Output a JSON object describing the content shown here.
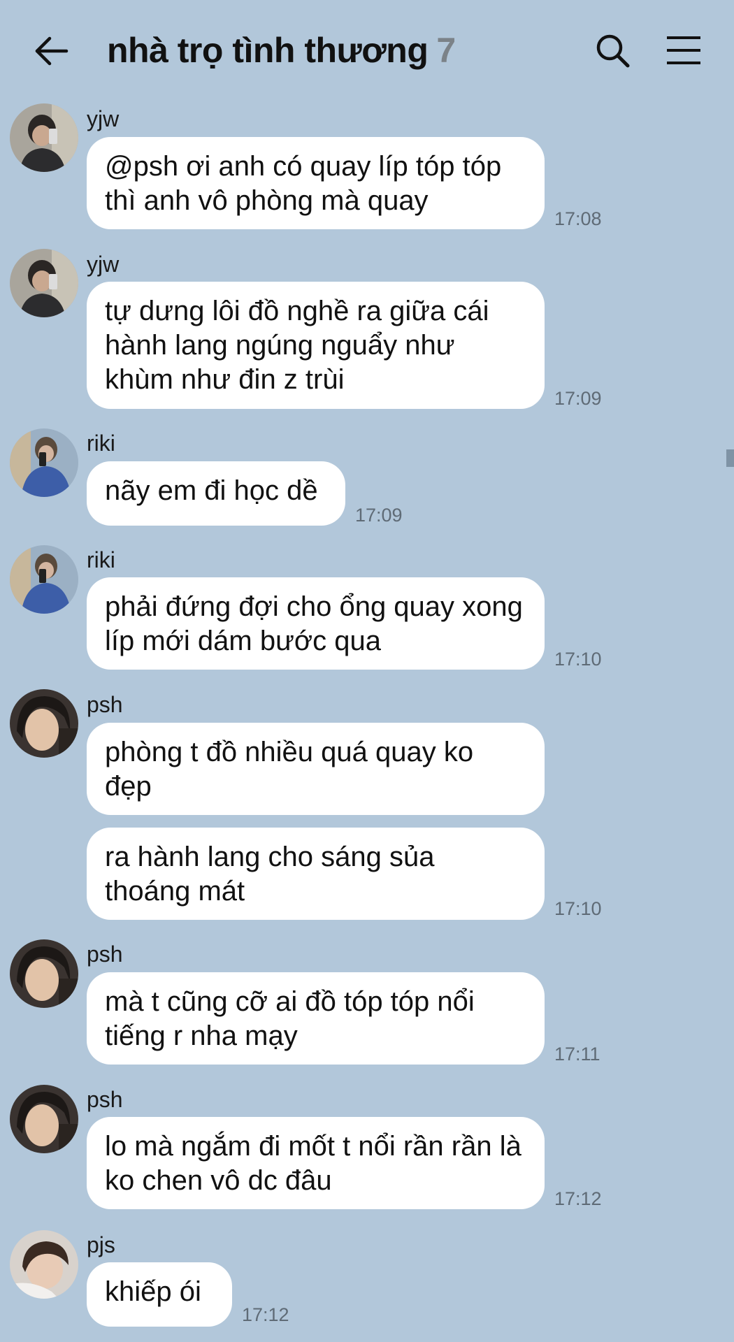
{
  "header": {
    "title": "nhà trọ tình thương",
    "member_count": "7"
  },
  "messages": [
    {
      "sender": "yjw",
      "text": "@psh ơi anh có quay líp tóp tóp thì anh vô phòng mà quay",
      "time": "17:08"
    },
    {
      "sender": "yjw",
      "text": "tự dưng lôi đồ nghề ra giữa cái hành lang ngúng nguẩy như khùm như đin z trùi",
      "time": "17:09"
    },
    {
      "sender": "riki",
      "text": "nãy em đi học dề",
      "time": "17:09"
    },
    {
      "sender": "riki",
      "text": "phải đứng đợi cho ổng quay xong líp mới dám bước qua",
      "time": "17:10"
    },
    {
      "sender": "psh",
      "text": "phòng t đồ nhiều quá quay ko đẹp"
    },
    {
      "text": "ra hành lang cho sáng sủa thoáng mát",
      "time": "17:10"
    },
    {
      "sender": "psh",
      "text": "mà t cũng cỡ ai đồ tóp tóp nổi tiếng r nha mạy",
      "time": "17:11"
    },
    {
      "sender": "psh",
      "text": "lo mà ngắm đi mốt t nổi rần rần là ko chen vô dc đâu",
      "time": "17:12"
    },
    {
      "sender": "pjs",
      "text": "khiếp ói",
      "time": "17:12"
    }
  ],
  "icons": {
    "back": "arrow-left-icon",
    "search": "search-icon",
    "menu": "hamburger-menu-icon"
  },
  "colors": {
    "background": "#b2c7da",
    "bubble": "#ffffff",
    "timestamp": "#5f6b76",
    "count": "#7b8288"
  }
}
